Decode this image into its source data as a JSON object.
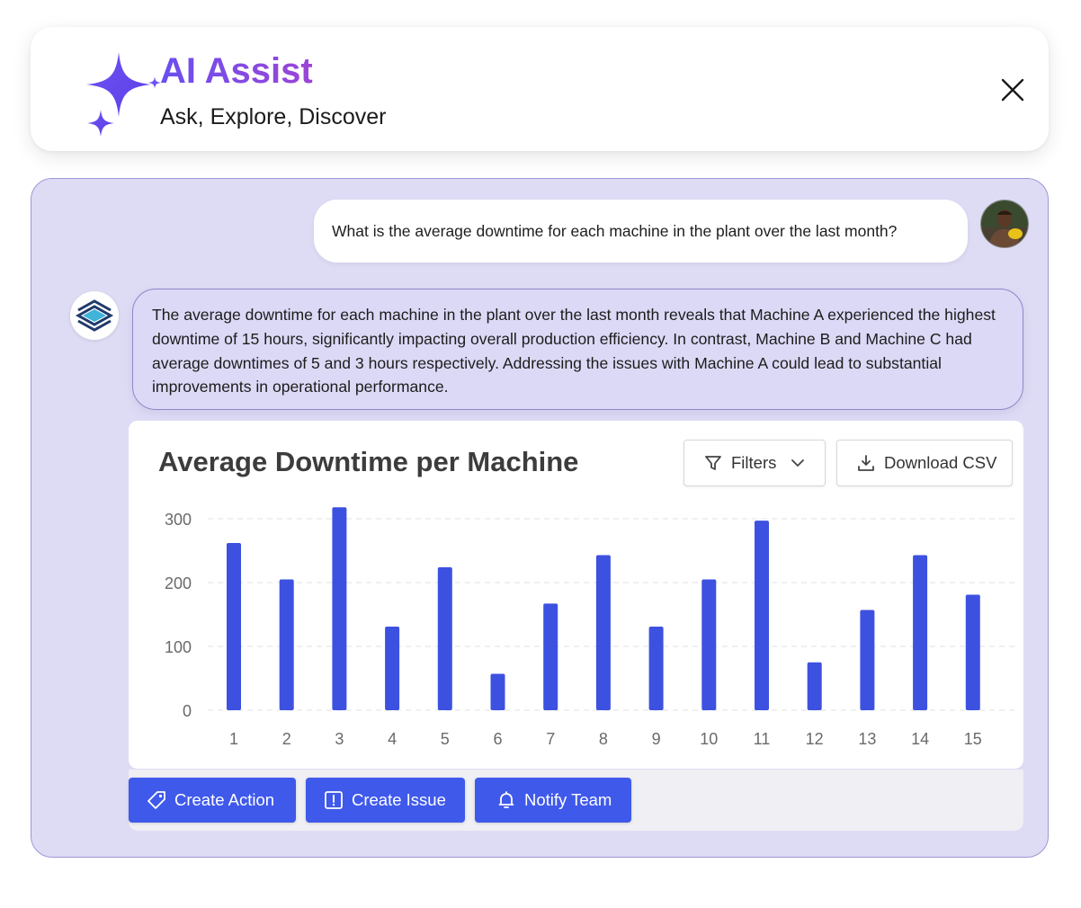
{
  "header": {
    "title": "AI Assist",
    "subtitle": "Ask, Explore, Discover",
    "logo_icon": "sparkles-icon",
    "close_icon": "close-icon"
  },
  "conversation": {
    "user_message": "What is the average downtime for each machine in the plant over the last month?",
    "assistant_message": "The average downtime for each machine in the plant over the last month reveals that Machine A experienced the highest downtime of 15 hours, significantly impacting overall production efficiency. In contrast, Machine B and Machine C had average downtimes of 5 and 3 hours respectively. Addressing the issues with Machine A could lead to substantial improvements in operational performance."
  },
  "chart_card": {
    "filters_label": "Filters",
    "download_label": "Download CSV"
  },
  "chart_data": {
    "type": "bar",
    "title": "Average Downtime per Machine",
    "categories": [
      "1",
      "2",
      "3",
      "4",
      "5",
      "6",
      "7",
      "8",
      "9",
      "10",
      "11",
      "12",
      "13",
      "14",
      "15"
    ],
    "values": [
      262,
      205,
      318,
      131,
      224,
      57,
      167,
      243,
      131,
      205,
      297,
      75,
      157,
      243,
      181
    ],
    "yticks": [
      0,
      100,
      200,
      300
    ],
    "ylim": [
      0,
      300
    ],
    "xlabel": "",
    "ylabel": "",
    "bar_color": "#3d51e0",
    "grid": true
  },
  "actions": {
    "create_action": "Create Action",
    "create_issue": "Create Issue",
    "notify_team": "Notify Team"
  },
  "colors": {
    "accent": "#3f59eb",
    "title_gradient_start": "#6a4ff0",
    "title_gradient_end": "#9b45d6",
    "panel_background": "#dedcf5"
  }
}
